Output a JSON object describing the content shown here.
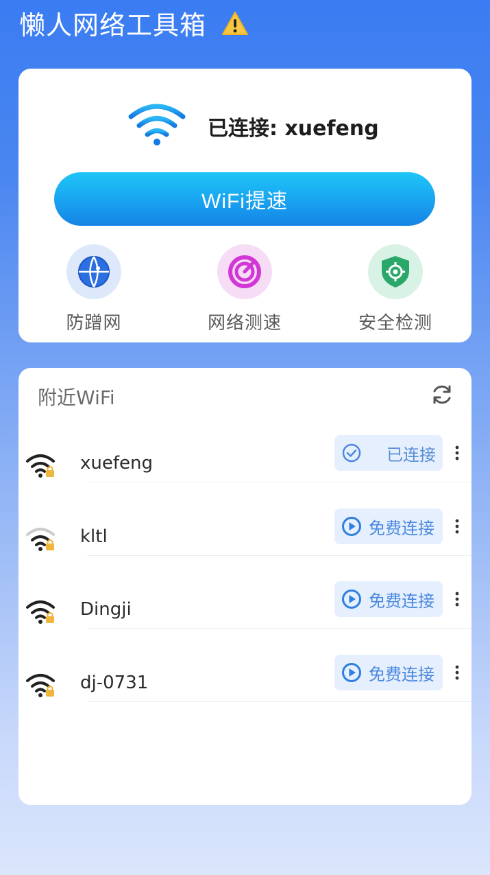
{
  "app": {
    "title": "懒人网络工具箱"
  },
  "status": {
    "connected_text": "已连接: xuefeng"
  },
  "boost_button": {
    "label": "WiFi提速"
  },
  "features": [
    {
      "label": "防蹭网",
      "icon": "globe-icon"
    },
    {
      "label": "网络测速",
      "icon": "speedometer-icon"
    },
    {
      "label": "安全检测",
      "icon": "shield-icon"
    }
  ],
  "nearby": {
    "title": "附近WiFi",
    "networks": [
      {
        "name": "xuefeng",
        "action": "已连接",
        "state": "connected"
      },
      {
        "name": "kltl",
        "action": "免费连接",
        "state": "available"
      },
      {
        "name": "Dingji",
        "action": "免费连接",
        "state": "available"
      },
      {
        "name": "dj-0731",
        "action": "免费连接",
        "state": "available"
      }
    ]
  },
  "colors": {
    "accent": "#1a9cf0",
    "header_bg": "#3a7cf2",
    "action_bg": "#e6effd",
    "action_text": "#4a88e0"
  }
}
